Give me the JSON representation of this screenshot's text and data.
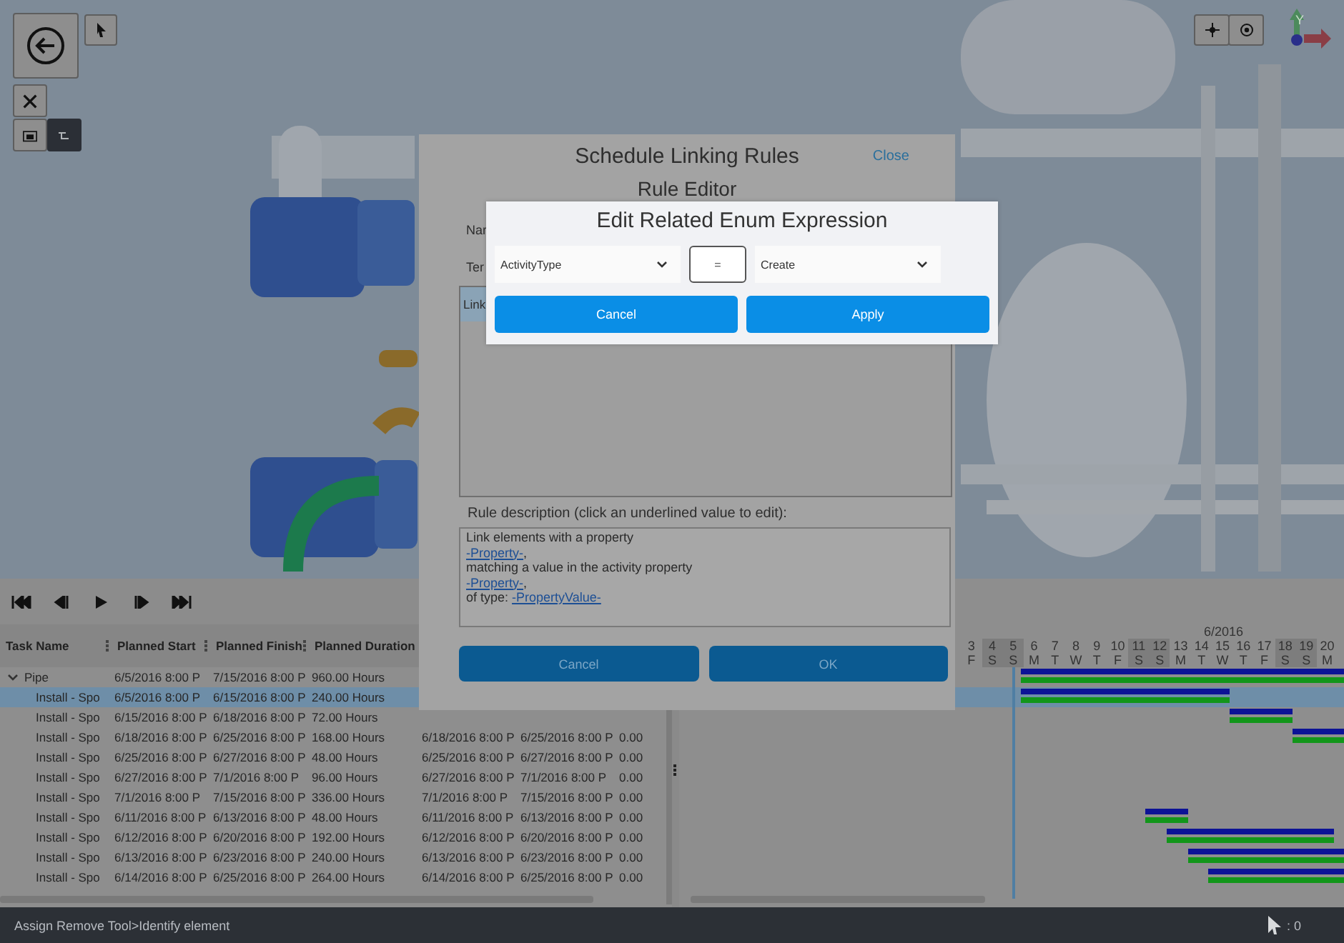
{
  "viewport": {
    "axis_label": "Y"
  },
  "table": {
    "columns": [
      "Task Name",
      "Planned Start",
      "Planned Finish",
      "Planned Duration"
    ],
    "rows": [
      {
        "name": "Pipe",
        "start": "6/5/2016 8:00 P",
        "finish": "7/15/2016 8:00 P",
        "duration": "960.00 Hours",
        "expanded": true,
        "selected": false,
        "children": [
          {
            "name": "Install - Spo",
            "start": "6/5/2016 8:00 P",
            "finish": "6/15/2016 8:00 P",
            "duration": "240.00 Hours",
            "selected": true
          },
          {
            "name": "Install - Spo",
            "start": "6/15/2016 8:00 P",
            "finish": "6/18/2016 8:00 P",
            "duration": "72.00 Hours",
            "selected": false
          },
          {
            "name": "Install - Spo",
            "start": "6/18/2016 8:00 P",
            "finish": "6/25/2016 8:00 P",
            "duration": "168.00 Hours",
            "selected": false,
            "extra": [
              "6/18/2016 8:00 P",
              "6/25/2016 8:00 P",
              "0.00"
            ]
          },
          {
            "name": "Install - Spo",
            "start": "6/25/2016 8:00 P",
            "finish": "6/27/2016 8:00 P",
            "duration": "48.00 Hours",
            "selected": false,
            "extra": [
              "6/25/2016 8:00 P",
              "6/27/2016 8:00 P",
              "0.00"
            ]
          },
          {
            "name": "Install - Spo",
            "start": "6/27/2016 8:00 P",
            "finish": "7/1/2016 8:00 P",
            "duration": "96.00 Hours",
            "selected": false,
            "extra": [
              "6/27/2016 8:00 P",
              "7/1/2016 8:00 P",
              "0.00"
            ]
          },
          {
            "name": "Install - Spo",
            "start": "7/1/2016 8:00 P",
            "finish": "7/15/2016 8:00 P",
            "duration": "336.00 Hours",
            "selected": false,
            "extra": [
              "7/1/2016 8:00 P",
              "7/15/2016 8:00 P",
              "0.00"
            ]
          },
          {
            "name": "Install - Spo",
            "start": "6/11/2016 8:00 P",
            "finish": "6/13/2016 8:00 P",
            "duration": "48.00 Hours",
            "selected": false,
            "extra": [
              "6/11/2016 8:00 P",
              "6/13/2016 8:00 P",
              "0.00"
            ]
          },
          {
            "name": "Install - Spo",
            "start": "6/12/2016 8:00 P",
            "finish": "6/20/2016 8:00 P",
            "duration": "192.00 Hours",
            "selected": false,
            "extra": [
              "6/12/2016 8:00 P",
              "6/20/2016 8:00 P",
              "0.00"
            ]
          },
          {
            "name": "Install - Spo",
            "start": "6/13/2016 8:00 P",
            "finish": "6/23/2016 8:00 P",
            "duration": "240.00 Hours",
            "selected": false,
            "extra": [
              "6/13/2016 8:00 P",
              "6/23/2016 8:00 P",
              "0.00"
            ]
          },
          {
            "name": "Install - Spo",
            "start": "6/14/2016 8:00 P",
            "finish": "6/25/2016 8:00 P",
            "duration": "264.00 Hours",
            "selected": false,
            "extra": [
              "6/14/2016 8:00 P",
              "6/25/2016 8:00 P",
              "0.00"
            ]
          }
        ]
      }
    ]
  },
  "gantt": {
    "month": "6/2016",
    "days": [
      {
        "num": "3",
        "weekday": "F",
        "weekend": false
      },
      {
        "num": "4",
        "weekday": "S",
        "weekend": true
      },
      {
        "num": "5",
        "weekday": "S",
        "weekend": true
      },
      {
        "num": "6",
        "weekday": "M",
        "weekend": false
      },
      {
        "num": "7",
        "weekday": "T",
        "weekend": false
      },
      {
        "num": "8",
        "weekday": "W",
        "weekend": false
      },
      {
        "num": "9",
        "weekday": "T",
        "weekend": false
      },
      {
        "num": "10",
        "weekday": "F",
        "weekend": false
      },
      {
        "num": "11",
        "weekday": "S",
        "weekend": true
      },
      {
        "num": "12",
        "weekday": "S",
        "weekend": true
      },
      {
        "num": "13",
        "weekday": "M",
        "weekend": false
      },
      {
        "num": "14",
        "weekday": "T",
        "weekend": false
      },
      {
        "num": "15",
        "weekday": "W",
        "weekend": false
      },
      {
        "num": "16",
        "weekday": "T",
        "weekend": false
      },
      {
        "num": "17",
        "weekday": "F",
        "weekend": false
      },
      {
        "num": "18",
        "weekday": "S",
        "weekend": true
      },
      {
        "num": "19",
        "weekday": "S",
        "weekend": true
      },
      {
        "num": "20",
        "weekday": "M",
        "weekend": false
      }
    ]
  },
  "rules_dialog": {
    "title": "Schedule Linking Rules",
    "close": "Close",
    "subtitle": "Rule Editor",
    "fields": [
      {
        "label": "Nar"
      },
      {
        "label": "Ter"
      }
    ],
    "list": [
      {
        "label": "Link",
        "selected": true
      }
    ],
    "description_label": "Rule description (click an underlined value to edit):",
    "description": [
      {
        "kind": "text",
        "text": "Link elements with a property"
      },
      {
        "kind": "link",
        "link": "-Property-",
        "suffix": ","
      },
      {
        "kind": "text",
        "text": "matching a value in the activity property"
      },
      {
        "kind": "link",
        "link": "-Property-",
        "suffix": ","
      },
      {
        "kind": "link",
        "prefix": "of type: ",
        "link": "-PropertyValue-"
      }
    ],
    "buttons": [
      "Cancel",
      "OK"
    ]
  },
  "expression_dialog": {
    "title": "Edit Related Enum Expression",
    "left_select": "ActivityType",
    "operator": "=",
    "right_select": "Create",
    "buttons": [
      "Cancel",
      "Apply"
    ]
  },
  "status_bar": {
    "message": "Assign Remove Tool>Identify element",
    "count": ": 0"
  }
}
